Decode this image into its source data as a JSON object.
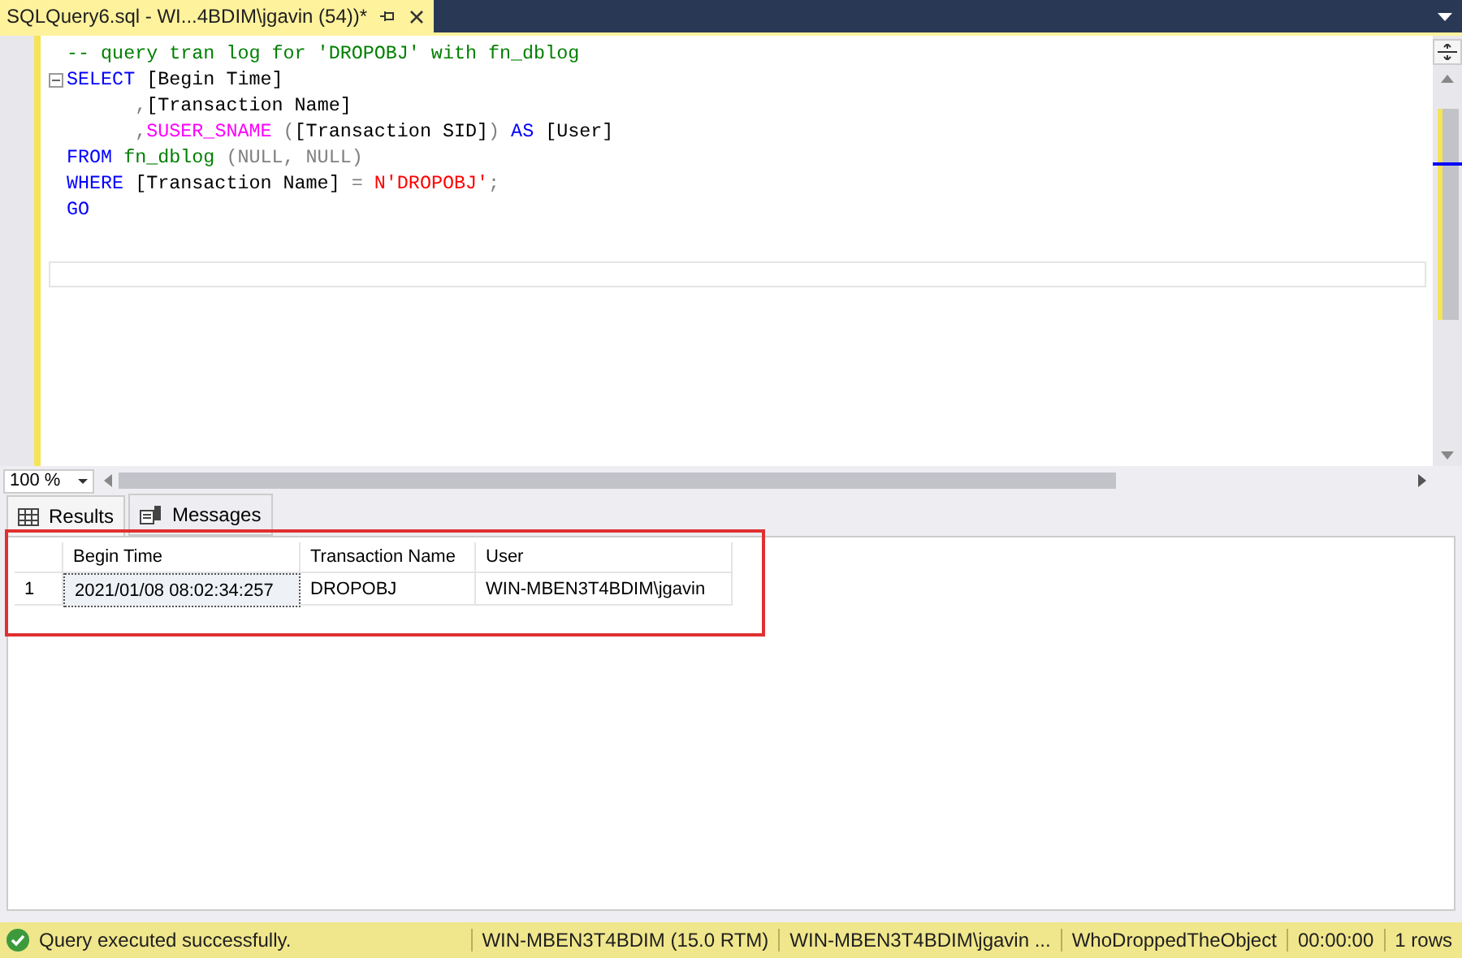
{
  "document_tab": {
    "title": "SQLQuery6.sql - WI...4BDIM\\jgavin (54))*",
    "modified": true
  },
  "editor": {
    "lines": [
      {
        "collapsible": false,
        "tokens": [
          {
            "kind": "comment",
            "text": "-- query tran log for 'DROPOBJ' with fn_dblog"
          }
        ]
      },
      {
        "collapsible": true,
        "tokens": [
          {
            "kind": "keyword",
            "text": "SELECT"
          },
          {
            "kind": "plain",
            "text": " [Begin Time]"
          }
        ]
      },
      {
        "collapsible": false,
        "tokens": [
          {
            "kind": "operator",
            "text": "      ,"
          },
          {
            "kind": "plain",
            "text": "[Transaction Name]"
          }
        ]
      },
      {
        "collapsible": false,
        "tokens": [
          {
            "kind": "operator",
            "text": "      ,"
          },
          {
            "kind": "function",
            "text": "SUSER_SNAME"
          },
          {
            "kind": "operator",
            "text": " ("
          },
          {
            "kind": "plain",
            "text": "[Transaction SID]"
          },
          {
            "kind": "operator",
            "text": ")"
          },
          {
            "kind": "keyword",
            "text": " AS"
          },
          {
            "kind": "plain",
            "text": " [User]"
          }
        ]
      },
      {
        "collapsible": false,
        "tokens": [
          {
            "kind": "keyword",
            "text": "FROM"
          },
          {
            "kind": "system",
            "text": " fn_dblog"
          },
          {
            "kind": "operator",
            "text": " (NULL, NULL)"
          }
        ]
      },
      {
        "collapsible": false,
        "tokens": [
          {
            "kind": "keyword",
            "text": "WHERE"
          },
          {
            "kind": "plain",
            "text": " [Transaction Name] "
          },
          {
            "kind": "operator",
            "text": "="
          },
          {
            "kind": "string",
            "text": " N'DROPOBJ'"
          },
          {
            "kind": "operator",
            "text": ";"
          }
        ]
      },
      {
        "collapsible": false,
        "tokens": [
          {
            "kind": "keyword",
            "text": "GO"
          }
        ]
      }
    ]
  },
  "zoom": {
    "value": "100 %"
  },
  "result_tabs": [
    {
      "label": "Results",
      "kind": "grid",
      "selected": true
    },
    {
      "label": "Messages",
      "kind": "messages",
      "selected": false
    }
  ],
  "results": {
    "columns": [
      "Begin Time",
      "Transaction Name",
      "User"
    ],
    "rows": [
      {
        "number": "1",
        "cells": [
          "2021/01/08 08:02:34:257",
          "DROPOBJ",
          "WIN-MBEN3T4BDIM\\jgavin"
        ]
      }
    ]
  },
  "status_bar": {
    "message": "Query executed successfully.",
    "items": [
      "WIN-MBEN3T4BDIM (15.0 RTM)",
      "WIN-MBEN3T4BDIM\\jgavin ...",
      "WhoDroppedTheObject",
      "00:00:00",
      "1 rows"
    ]
  }
}
